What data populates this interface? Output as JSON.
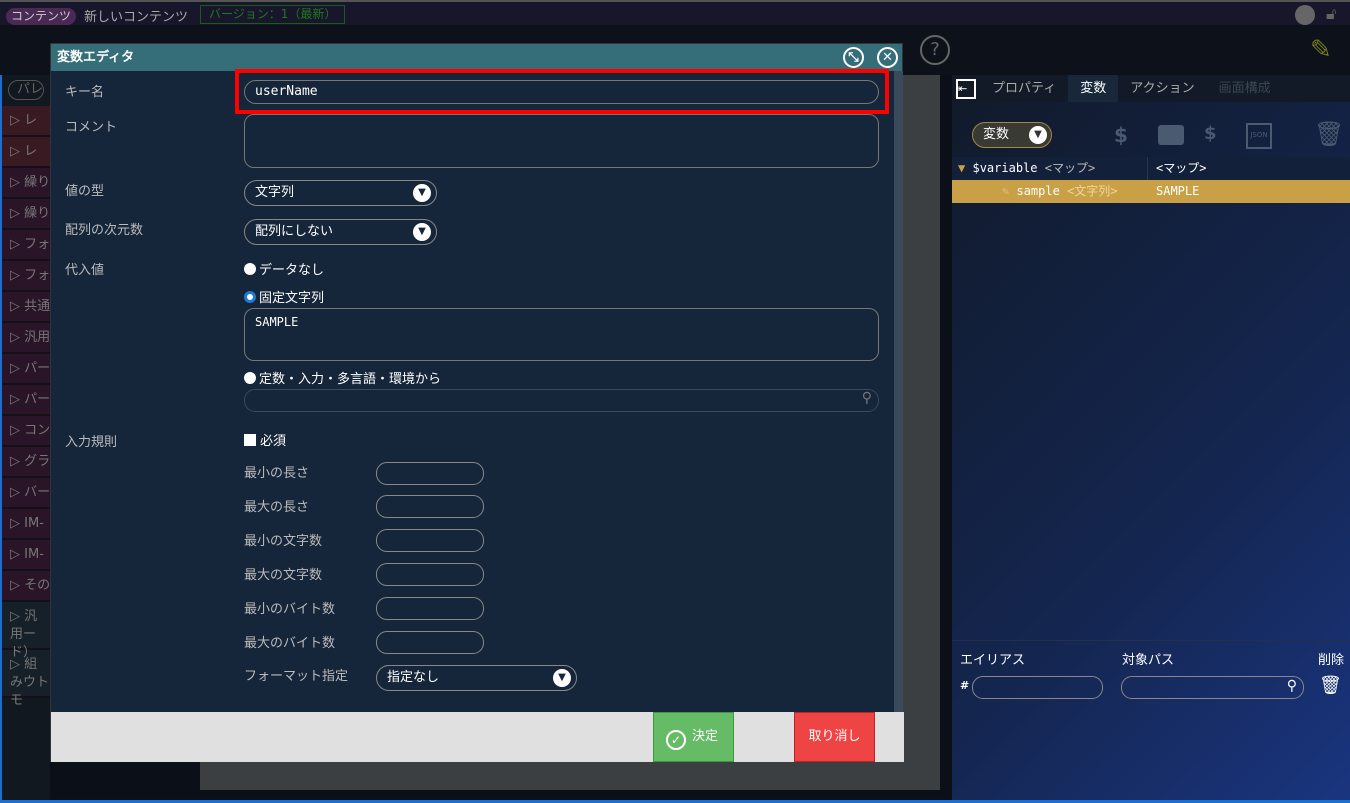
{
  "header": {
    "badge": "コンテンツ",
    "title": "新しいコンテンツ",
    "version": "バージョン：1（最新）"
  },
  "palette": {
    "search": "パレ",
    "items": [
      "レ",
      "レ",
      "繰り",
      "繰り",
      "フォ",
      "フォ",
      "共通",
      "汎用",
      "パー",
      "パー",
      "コン",
      "グラ",
      "バー",
      "IM-",
      "IM-",
      "その",
      "汎用ード）",
      "組みウトモ"
    ]
  },
  "dialog": {
    "title": "変数エディタ",
    "key_label": "キー名",
    "key_value": "userName",
    "comment_label": "コメント",
    "comment_value": "",
    "type_label": "値の型",
    "type_value": "文字列",
    "dim_label": "配列の次元数",
    "dim_value": "配列にしない",
    "assign_label": "代入値",
    "opt_none": "データなし",
    "opt_fixed": "固定文字列",
    "fixed_value": "SAMPLE",
    "opt_source": "定数・入力・多言語・環境から",
    "rule_label": "入力規則",
    "required": "必須",
    "rules": [
      "最小の長さ",
      "最大の長さ",
      "最小の文字数",
      "最大の文字数",
      "最小のバイト数",
      "最大のバイト数"
    ],
    "format_label": "フォーマット指定",
    "format_value": "指定なし",
    "ok": "決定",
    "cancel": "取り消し"
  },
  "right": {
    "tabs": [
      "プロパティ",
      "変数",
      "アクション",
      "画面構成"
    ],
    "scope": "変数",
    "tree": {
      "root": "$variable",
      "root_type": "<マップ>",
      "root_value": "<マップ>",
      "child": "sample",
      "child_type": "<文字列>",
      "child_value": "SAMPLE"
    },
    "alias_label": "エイリアス",
    "path_label": "対象パス",
    "delete_label": "削除",
    "hash": "#"
  },
  "colors": {
    "highlight": "#ff0000",
    "ok": "#66bb66",
    "cancel": "#ee4444",
    "selected_row": "#c9a045"
  }
}
